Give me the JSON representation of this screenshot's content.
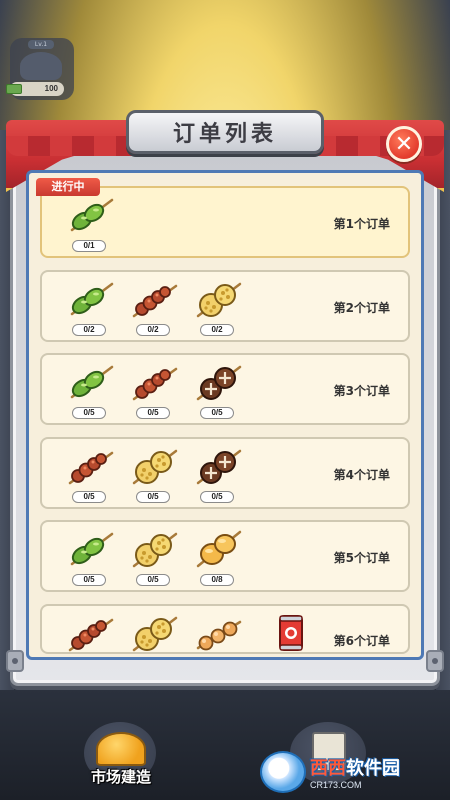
{
  "hud": {
    "level": "Lv.1",
    "cash": "100"
  },
  "dialog": {
    "title": "订单列表",
    "close_symbol": "✕",
    "status_tag": "进行中"
  },
  "orders": [
    {
      "label": "第1个订单",
      "items": [
        {
          "icon": "green-pepper-skewer-icon",
          "count": "0/1"
        }
      ]
    },
    {
      "label": "第2个订单",
      "items": [
        {
          "icon": "green-pepper-skewer-icon",
          "count": "0/2"
        },
        {
          "icon": "meat-skewer-icon",
          "count": "0/2"
        },
        {
          "icon": "lotus-root-skewer-icon",
          "count": "0/2"
        }
      ]
    },
    {
      "label": "第3个订单",
      "items": [
        {
          "icon": "green-pepper-skewer-icon",
          "count": "0/5"
        },
        {
          "icon": "meat-skewer-icon",
          "count": "0/5"
        },
        {
          "icon": "mushroom-skewer-icon",
          "count": "0/5"
        }
      ]
    },
    {
      "label": "第4个订单",
      "items": [
        {
          "icon": "meat-skewer-icon",
          "count": "0/5"
        },
        {
          "icon": "lotus-root-skewer-icon",
          "count": "0/5"
        },
        {
          "icon": "mushroom-skewer-icon",
          "count": "0/5"
        }
      ]
    },
    {
      "label": "第5个订单",
      "items": [
        {
          "icon": "green-pepper-skewer-icon",
          "count": "0/5"
        },
        {
          "icon": "lotus-root-skewer-icon",
          "count": "0/5"
        },
        {
          "icon": "tofu-skewer-icon",
          "count": "0/8"
        }
      ]
    },
    {
      "label": "第6个订单",
      "items": [
        {
          "icon": "meat-skewer-icon",
          "count": ""
        },
        {
          "icon": "lotus-root-skewer-icon",
          "count": ""
        },
        {
          "icon": "fishball-skewer-icon",
          "count": ""
        },
        {
          "icon": "soda-can-icon",
          "count": ""
        }
      ]
    }
  ],
  "bottom_nav": {
    "build_label": "市场建造"
  },
  "watermark": {
    "main_a": "西西",
    "main_b": "软件园",
    "sub": "CR173.COM"
  },
  "colors": {
    "accent_red": "#e33c2d",
    "frame_blue": "#4e79b5",
    "paper": "#f7efdc"
  }
}
